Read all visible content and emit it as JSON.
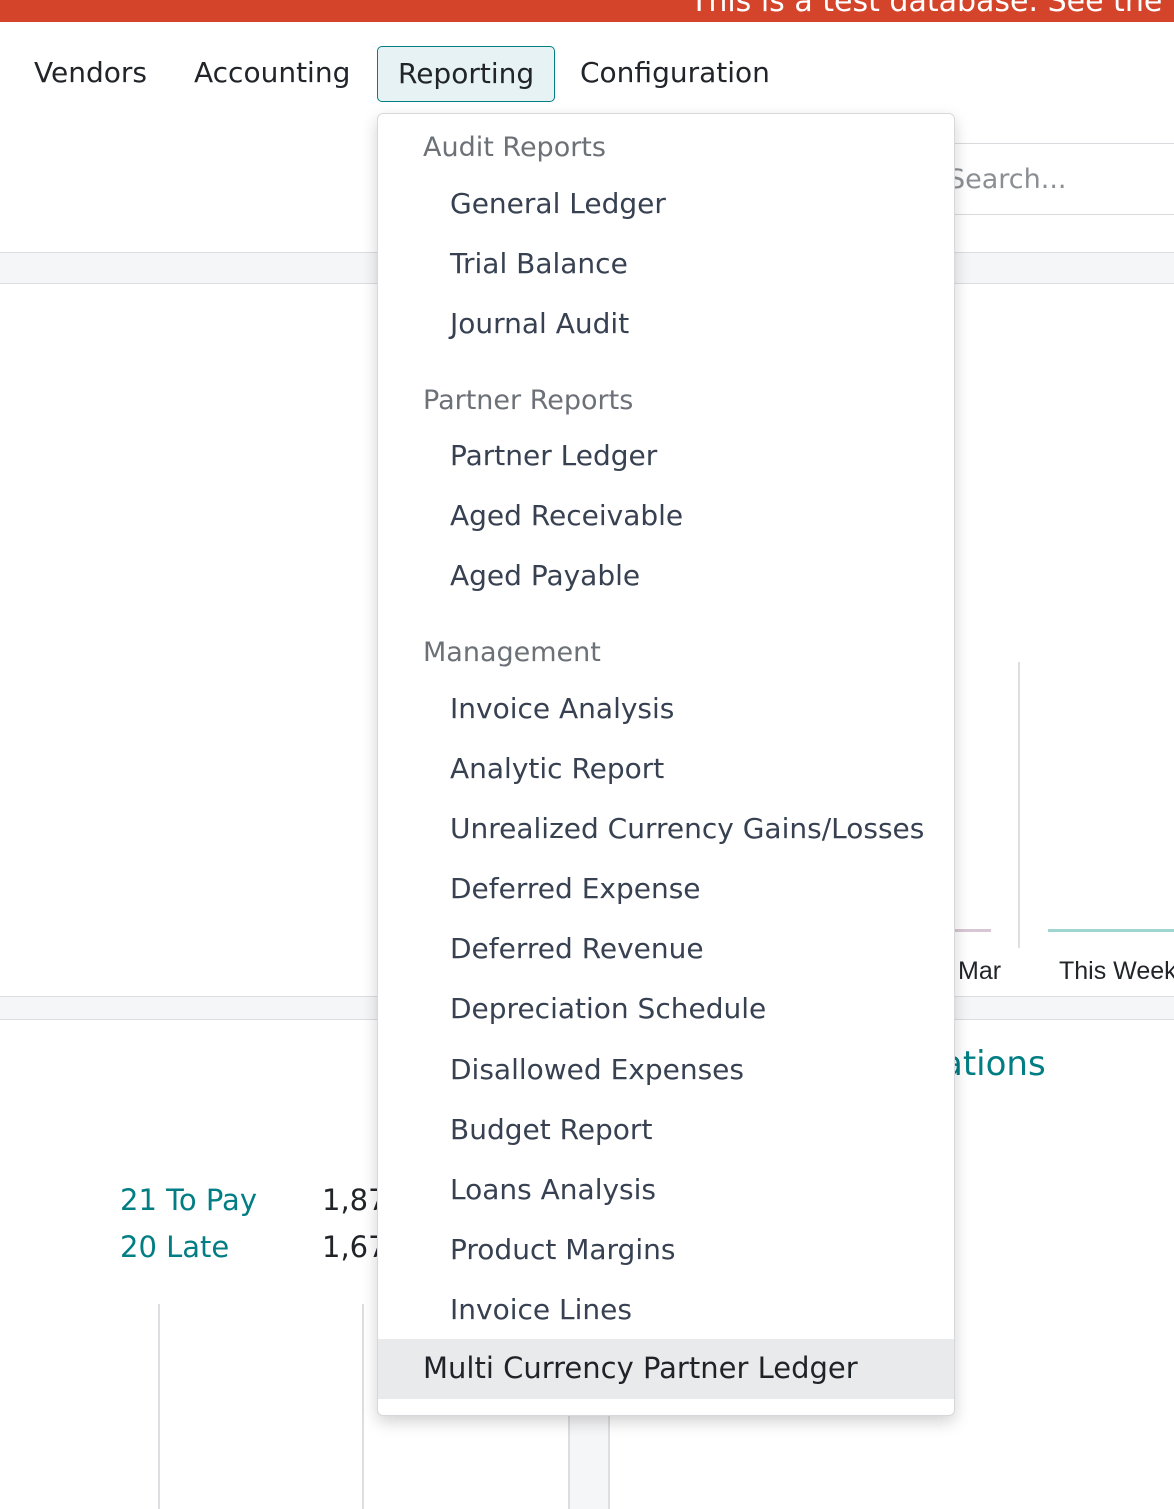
{
  "banner": {
    "text": "This is a test database. See the"
  },
  "menu": {
    "vendors": "Vendors",
    "accounting": "Accounting",
    "reporting": "Reporting",
    "configuration": "Configuration"
  },
  "search": {
    "placeholder": "Search..."
  },
  "chart": {
    "label_mar": "Mar",
    "label_this_week": "This Week"
  },
  "section": {
    "title": "rations"
  },
  "stats": [
    {
      "label": "21 To Pay",
      "value": "1,87"
    },
    {
      "label": "20 Late",
      "value": "1,67"
    }
  ],
  "dropdown": {
    "groups": [
      {
        "header": "Audit Reports",
        "items": [
          "General Ledger",
          "Trial Balance",
          "Journal Audit"
        ]
      },
      {
        "header": "Partner Reports",
        "items": [
          "Partner Ledger",
          "Aged Receivable",
          "Aged Payable"
        ]
      },
      {
        "header": "Management",
        "items": [
          "Invoice Analysis",
          "Analytic Report",
          "Unrealized Currency Gains/Losses",
          "Deferred Expense",
          "Deferred Revenue",
          "Depreciation Schedule",
          "Disallowed Expenses",
          "Budget Report",
          "Loans Analysis",
          "Product Margins",
          "Invoice Lines"
        ]
      }
    ],
    "highlighted": "Multi Currency Partner Ledger"
  },
  "colors": {
    "banner": "#d4442b",
    "accent": "#017e84"
  }
}
